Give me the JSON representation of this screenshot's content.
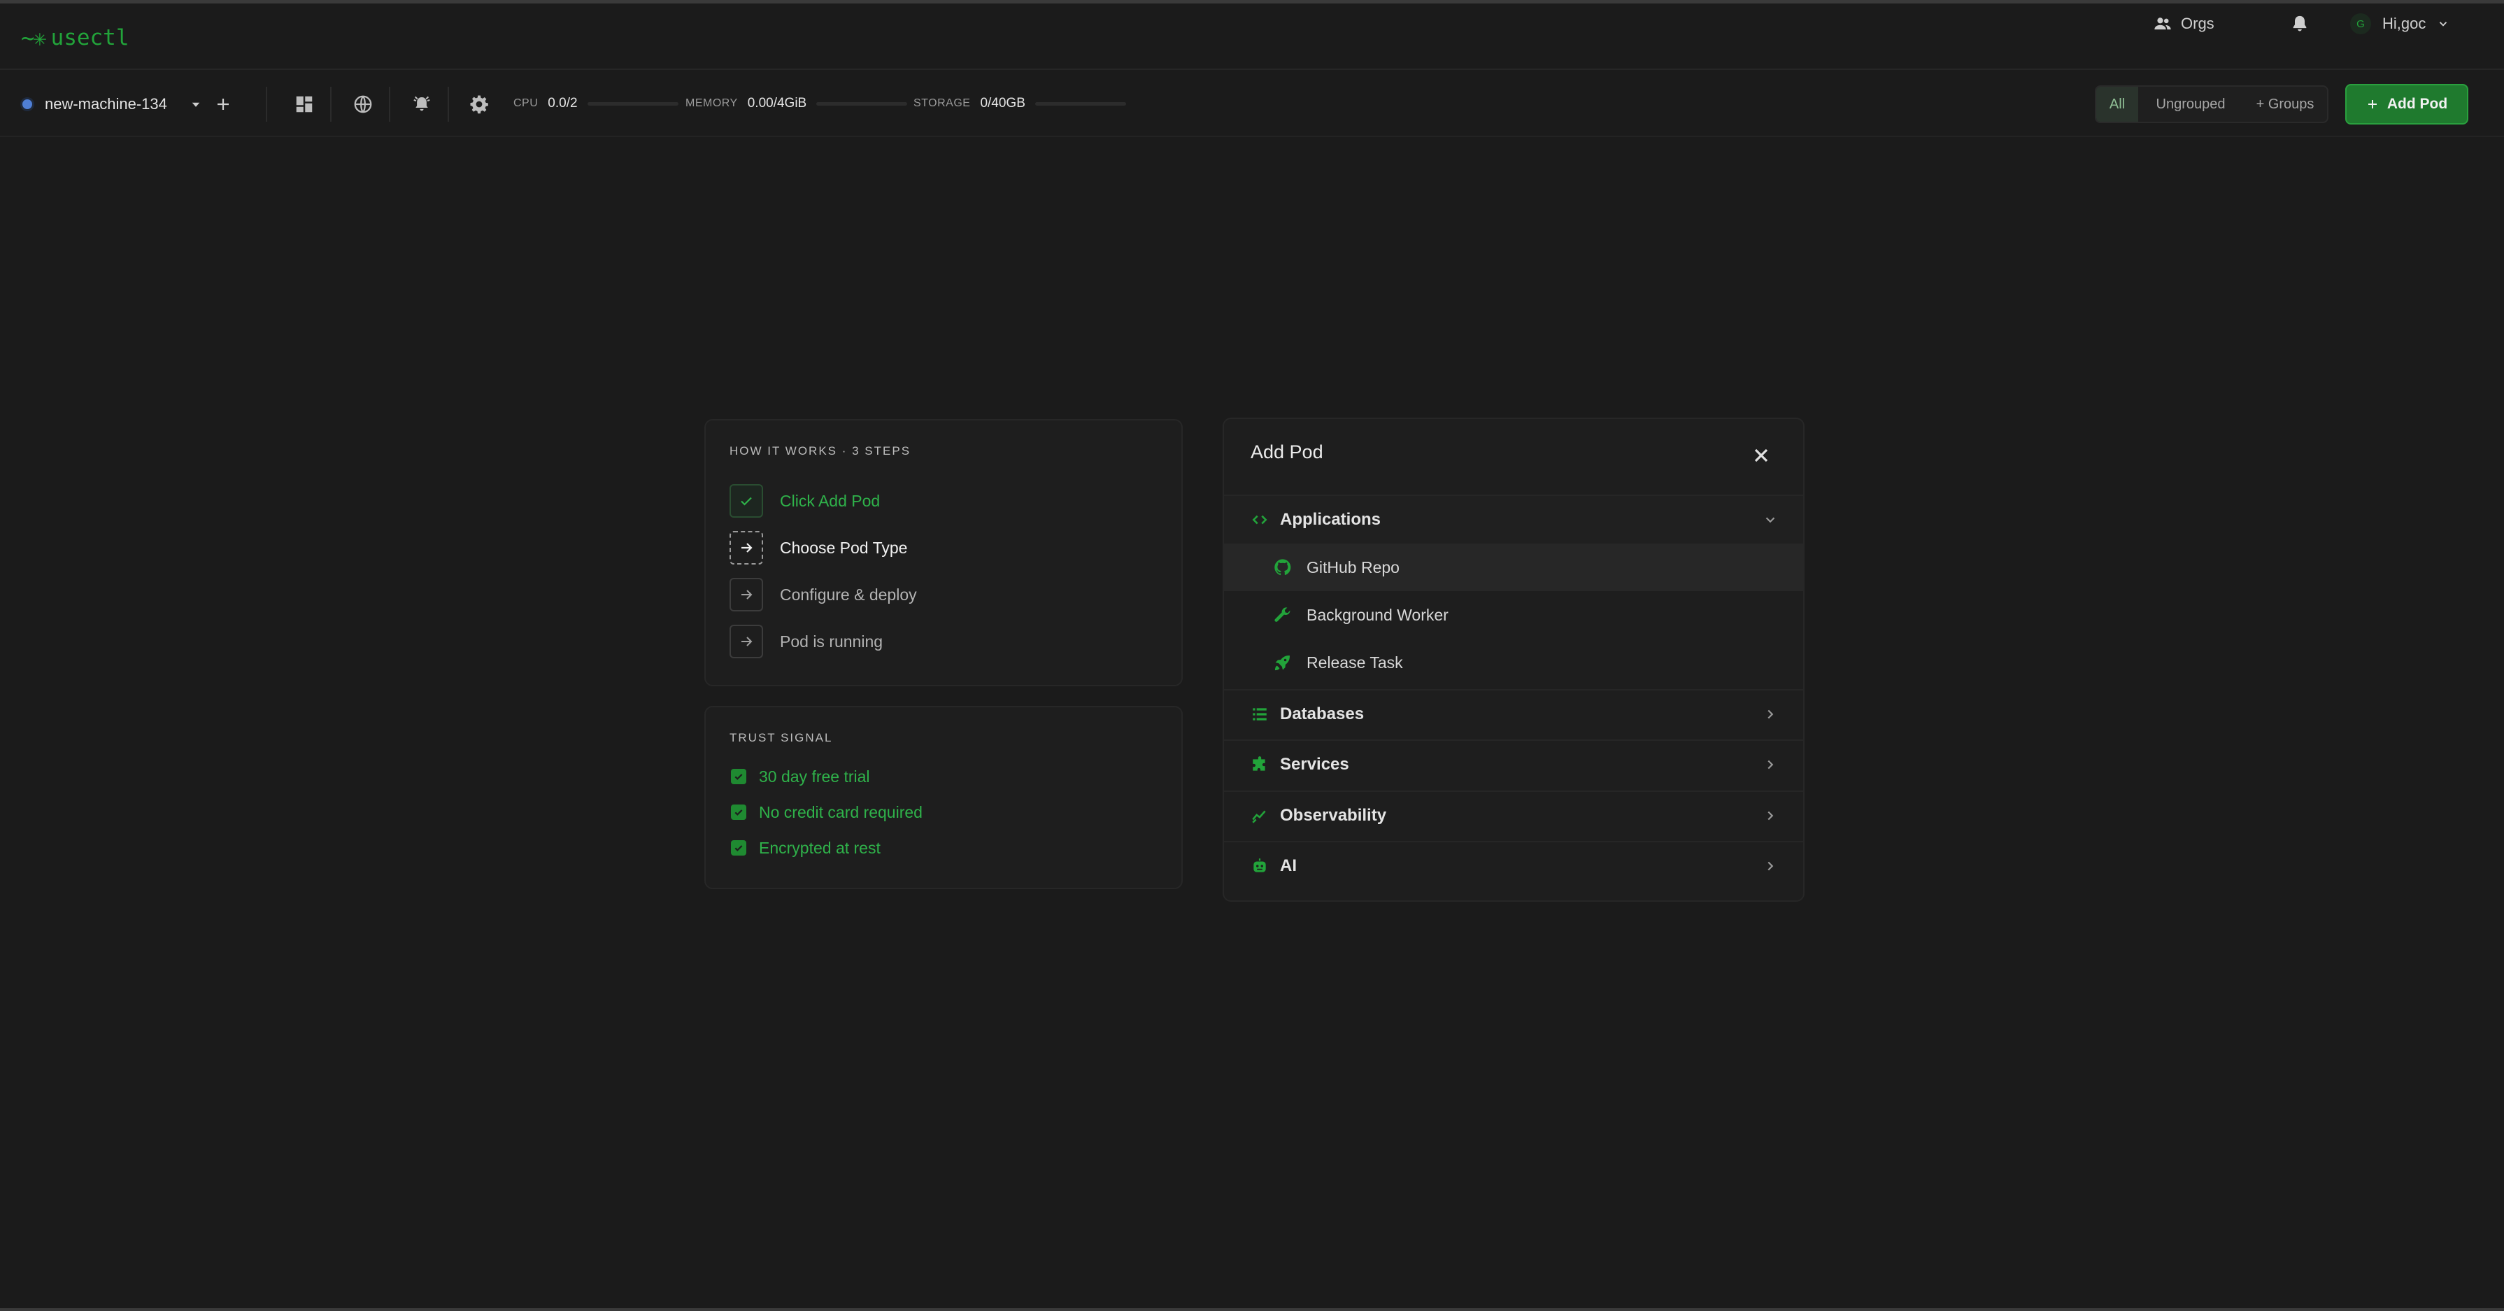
{
  "app": {
    "logo_text": "usectl",
    "logo_mark": "~✳"
  },
  "header": {
    "orgs_label": "Orgs",
    "user_label": "Hi,goc",
    "avatar_initial": "G"
  },
  "toolbar": {
    "machine_name": "new-machine-134",
    "metrics": {
      "cpu": {
        "label": "CPU",
        "value": "0.0/2",
        "fraction": 0
      },
      "memory": {
        "label": "MEMORY",
        "value": "0.00/4GiB",
        "fraction": 0
      },
      "storage": {
        "label": "STORAGE",
        "value": "0/40GB",
        "fraction": 0
      }
    },
    "filters": {
      "all": "All",
      "ungrouped": "Ungrouped",
      "groups": "+ Groups",
      "selected": "All"
    },
    "add_pod_label": "Add Pod"
  },
  "steps_card": {
    "title": "HOW IT WORKS · 3 STEPS",
    "steps": [
      {
        "label": "Click Add Pod",
        "state": "done"
      },
      {
        "label": "Choose Pod Type",
        "state": "active"
      },
      {
        "label": "Configure & deploy",
        "state": "todo"
      },
      {
        "label": "Pod is running",
        "state": "todo"
      }
    ]
  },
  "trust_card": {
    "title": "TRUST SIGNAL",
    "items": [
      "30 day free trial",
      "No credit card required",
      "Encrypted at rest"
    ]
  },
  "add_pod_panel": {
    "title": "Add Pod",
    "categories": [
      {
        "label": "Applications",
        "icon": "code-icon",
        "expanded": true,
        "items": [
          {
            "label": "GitHub Repo",
            "icon": "github-icon"
          },
          {
            "label": "Background Worker",
            "icon": "wrench-icon"
          },
          {
            "label": "Release Task",
            "icon": "rocket-icon"
          }
        ]
      },
      {
        "label": "Databases",
        "icon": "list-icon",
        "expanded": false
      },
      {
        "label": "Services",
        "icon": "puzzle-icon",
        "expanded": false
      },
      {
        "label": "Observability",
        "icon": "trend-icon",
        "expanded": false
      },
      {
        "label": "AI",
        "icon": "robot-icon",
        "expanded": false
      }
    ]
  },
  "colors": {
    "accent": "#22a33a",
    "background": "#1b1b1b",
    "card": "#1e1e1e",
    "button": "#1f7a2e"
  }
}
